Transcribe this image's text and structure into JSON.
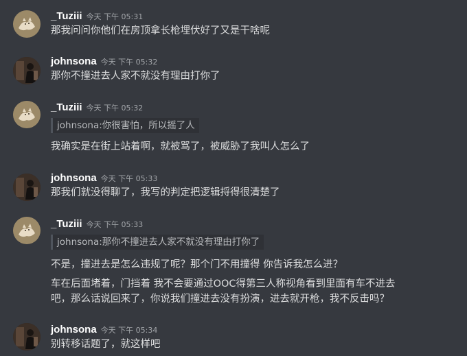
{
  "messages": [
    {
      "username": "_Tuziii",
      "timestamp": "今天 下午 05:31",
      "lines": [
        "那我问问你他们在房顶拿长枪埋伏好了又是干啥呢"
      ]
    },
    {
      "username": "johnsona",
      "timestamp": "今天 下午 05:32",
      "lines": [
        "那你不撞进去人家不就没有理由打你了"
      ]
    },
    {
      "username": "_Tuziii",
      "timestamp": "今天 下午 05:32",
      "quote": "johnsona:你很害怕，所以摇了人",
      "lines": [
        "我确实是在街上站着啊，就被骂了，被威胁了我叫人怎么了"
      ]
    },
    {
      "username": "johnsona",
      "timestamp": "今天 下午 05:33",
      "lines": [
        "那我们就没得聊了，我写的判定把逻辑捋得很清楚了"
      ]
    },
    {
      "username": "_Tuziii",
      "timestamp": "今天 下午 05:33",
      "quote": "johnsona:那你不撞进去人家不就没有理由打你了",
      "lines": [
        "不是，撞进去是怎么违规了呢？那个门不用撞得 你告诉我怎么进？",
        "车在后面堵着，门挡着 我不会要通过OOC得第三人称视角看到里面有车不进去",
        "吧，那么话说回来了，你说我们撞进去没有扮演，进去就开枪，我不反击吗？"
      ]
    },
    {
      "username": "johnsona",
      "timestamp": "今天 下午 05:34",
      "lines": [
        "别转移话题了，就这样吧"
      ]
    }
  ]
}
